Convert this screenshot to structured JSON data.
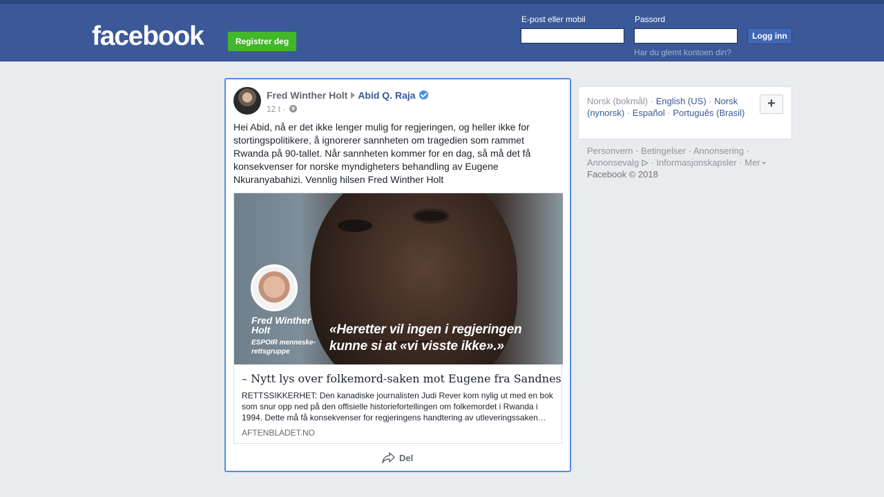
{
  "header": {
    "logo": "facebook",
    "register_label": "Registrer deg",
    "email_label": "E-post eller mobil",
    "password_label": "Passord",
    "login_label": "Logg inn",
    "forgot_label": "Har du glemt kontoen din?",
    "brand_color": "#3b5998"
  },
  "post": {
    "author": "Fred Winther Holt",
    "target": "Abid Q. Raja",
    "time": "12 t ·",
    "text": "Hei Abid, nå er det ikke lenger mulig for regjeringen, og heller ikke for stortingspolitikere, å ignorerer sannheten om tragedien som rammet Rwanda på 90-tallet. Når sannheten kommer for en dag, så må det få konsekvenser for norske myndigheters behandling av Eugene Nkuranyabahizi. Vennlig hilsen Fred Winther Holt",
    "link": {
      "image_quote_mark": "”",
      "image_name": "Fred Winther Holt",
      "image_org": "ESPOIR menneske-rettsgruppe",
      "image_quote": "«Heretter vil ingen i regjeringen kunne si at «vi visste ikke».»",
      "title": "– Nytt lys over folkemord-saken mot Eugene fra Sandnes",
      "description": "RETTSSIKKERHET: Den kanadiske journalisten Judi Rever kom nylig ut med en bok som snur opp ned på den offisielle historiefortellingen om folkemordet i Rwanda i 1994. Dette må få konsekvenser for regjeringens handtering av utleveringssaken…",
      "domain": "aftenbladet.no"
    },
    "share_label": "Del"
  },
  "sidebar": {
    "lang_current": "Norsk (bokmål)",
    "lang_1": "English (US)",
    "lang_2": "Norsk (nynorsk)",
    "lang_3": "Español",
    "lang_4": "Português (Brasil)",
    "plus": "+",
    "footer": {
      "privacy": "Personvern",
      "terms": "Betingelser",
      "ads": "Annonsering",
      "ad_choices": "Annonsevalg",
      "cookies": "Informasjonskapsler",
      "more": "Mer",
      "copyright": "Facebook © 2018"
    }
  }
}
